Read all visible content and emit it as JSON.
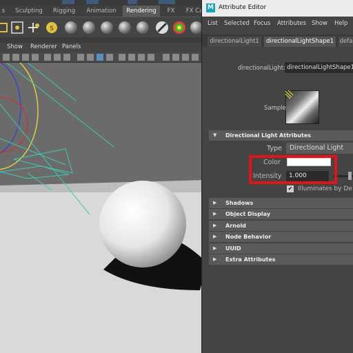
{
  "shelf_tabs": [
    {
      "label": "s",
      "active": false
    },
    {
      "label": "Sculpting",
      "active": false
    },
    {
      "label": "Rigging",
      "active": false
    },
    {
      "label": "Animation",
      "active": false
    },
    {
      "label": "Rendering",
      "active": true
    },
    {
      "label": "FX",
      "active": false
    },
    {
      "label": "FX Ca",
      "active": false
    }
  ],
  "viewport_menu": [
    "Show",
    "Renderer",
    "Panels"
  ],
  "attribute_editor": {
    "title": "Attribute Editor",
    "menu": [
      "List",
      "Selected",
      "Focus",
      "Attributes",
      "Show",
      "Help"
    ],
    "tabs": [
      {
        "label": "directionalLight1",
        "active": false
      },
      {
        "label": "directionalLightShape1",
        "active": true
      },
      {
        "label": "defa",
        "active": false
      }
    ],
    "node_label": "directionalLight:",
    "node_value": "directionalLightShape1",
    "sample_label": "Sample",
    "section_main": "Directional Light Attributes",
    "type_label": "Type",
    "type_value": "Directional Light",
    "color_label": "Color",
    "color_value": "#ffffff",
    "intensity_label": "Intensity",
    "intensity_value": "1.000",
    "illuminates_label": "Illuminates by De",
    "illuminates_checked": true,
    "sections": [
      "Shadows",
      "Object Display",
      "Arnold",
      "Node Behavior",
      "UUID",
      "Extra Attributes"
    ]
  },
  "colors": {
    "highlight_box": "#e1141d",
    "maya_logo": "#1aa6b7"
  }
}
